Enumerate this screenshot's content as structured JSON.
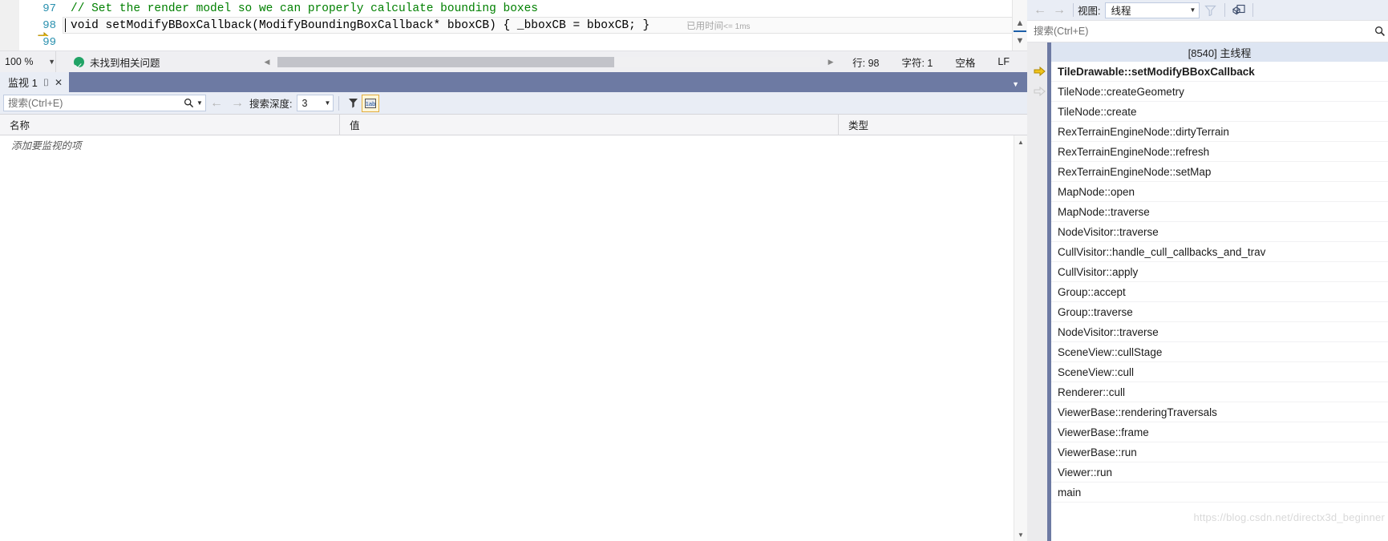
{
  "editor": {
    "lines": [
      {
        "num": "97",
        "text": "// Set the render model so we can properly calculate bounding boxes",
        "kind": "comment"
      },
      {
        "num": "98",
        "text": "void setModifyBBoxCallback(ModifyBoundingBoxCallback* bboxCB) { _bboxCB = bboxCB; }",
        "kind": "code"
      },
      {
        "num": "99",
        "text": "",
        "kind": "code"
      }
    ],
    "elapsed_label": "已用时间",
    "elapsed_value": "<= 1ms",
    "split_icon": "split-view-icon",
    "scroll_up_icon": "scroll-up-icon",
    "scroll_down_icon": "scroll-down-icon",
    "current_line_icon": "current-statement-arrow-icon"
  },
  "status_bar": {
    "zoom": "100 %",
    "zoom_caret_icon": "chevron-down-icon",
    "ok_icon": "status-ok-icon",
    "message": "未找到相关问题",
    "scroll_left_icon": "scroll-left-icon",
    "scroll_right_icon": "scroll-right-icon",
    "line": "行: 98",
    "column": "字符: 1",
    "indent": "空格",
    "line_ending": "LF"
  },
  "watch": {
    "tab_label": "监视 1",
    "pin_icon": "pin-icon",
    "close_icon": "close-icon",
    "strip_caret_icon": "chevron-down-icon",
    "search_placeholder": "搜索(Ctrl+E)",
    "search_value": "",
    "search_icon": "search-icon",
    "search_dropdown_icon": "chevron-down-icon",
    "back_icon": "arrow-left-icon",
    "forward_icon": "arrow-right-icon",
    "depth_label": "搜索深度:",
    "depth_value": "3",
    "depth_caret_icon": "chevron-down-icon",
    "filter_icon": "filter-icon",
    "hex_icon": "hex-display-icon",
    "columns": [
      "名称",
      "值",
      "类型"
    ],
    "empty_row": "添加要监视的项",
    "scroll_up_icon": "scroll-up-icon",
    "scroll_down_icon": "scroll-down-icon"
  },
  "callstack": {
    "back_icon": "arrow-left-icon",
    "forward_icon": "arrow-right-icon",
    "view_label": "视图:",
    "view_value": "线程",
    "view_caret_icon": "chevron-down-icon",
    "filter_icon": "funnel-filter-icon",
    "settings_icon": "callstack-settings-icon",
    "search_placeholder": "搜索(Ctrl+E)",
    "search_value": "",
    "search_icon": "search-icon",
    "thread_header": "[8540] 主线程",
    "current_frame_icon": "current-frame-arrow-icon",
    "parent_frame_icon": "parent-frame-arrow-icon",
    "frames": [
      {
        "name": "TileDrawable::setModifyBBoxCallback",
        "marker": "current"
      },
      {
        "name": "TileNode::createGeometry",
        "marker": "parent"
      },
      {
        "name": "TileNode::create",
        "marker": ""
      },
      {
        "name": "RexTerrainEngineNode::dirtyTerrain",
        "marker": ""
      },
      {
        "name": "RexTerrainEngineNode::refresh",
        "marker": ""
      },
      {
        "name": "RexTerrainEngineNode::setMap",
        "marker": ""
      },
      {
        "name": "MapNode::open",
        "marker": ""
      },
      {
        "name": "MapNode::traverse",
        "marker": ""
      },
      {
        "name": "NodeVisitor::traverse",
        "marker": ""
      },
      {
        "name": "CullVisitor::handle_cull_callbacks_and_trav",
        "marker": ""
      },
      {
        "name": "CullVisitor::apply",
        "marker": ""
      },
      {
        "name": "Group::accept",
        "marker": ""
      },
      {
        "name": "Group::traverse",
        "marker": ""
      },
      {
        "name": "NodeVisitor::traverse",
        "marker": ""
      },
      {
        "name": "SceneView::cullStage",
        "marker": ""
      },
      {
        "name": "SceneView::cull",
        "marker": ""
      },
      {
        "name": "Renderer::cull",
        "marker": ""
      },
      {
        "name": "ViewerBase::renderingTraversals",
        "marker": ""
      },
      {
        "name": "ViewerBase::frame",
        "marker": ""
      },
      {
        "name": "ViewerBase::run",
        "marker": ""
      },
      {
        "name": "Viewer::run",
        "marker": ""
      },
      {
        "name": "main",
        "marker": ""
      }
    ]
  },
  "watermark": "https://blog.csdn.net/directx3d_beginner"
}
